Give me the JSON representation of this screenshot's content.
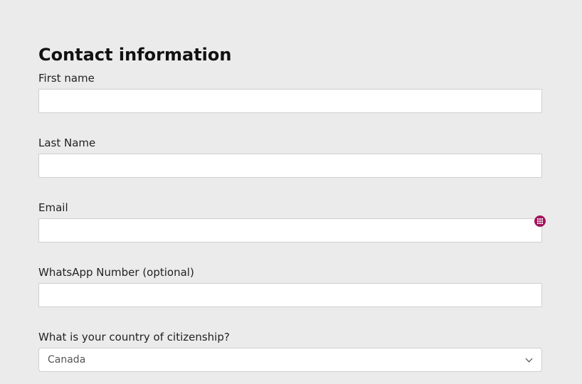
{
  "form": {
    "title": "Contact information",
    "fields": [
      {
        "label": "First name",
        "value": ""
      },
      {
        "label": "Last Name",
        "value": ""
      },
      {
        "label": "Email",
        "value": ""
      },
      {
        "label": "WhatsApp Number (optional)",
        "value": ""
      }
    ],
    "citizenship": {
      "label": "What is your country of citizenship?",
      "selected": "Canada"
    }
  },
  "colors": {
    "background": "#ebebeb",
    "badge": "#a3135d"
  },
  "icons": {
    "email_badge": "password-manager-grid-icon",
    "select_arrow": "chevron-down-icon"
  }
}
